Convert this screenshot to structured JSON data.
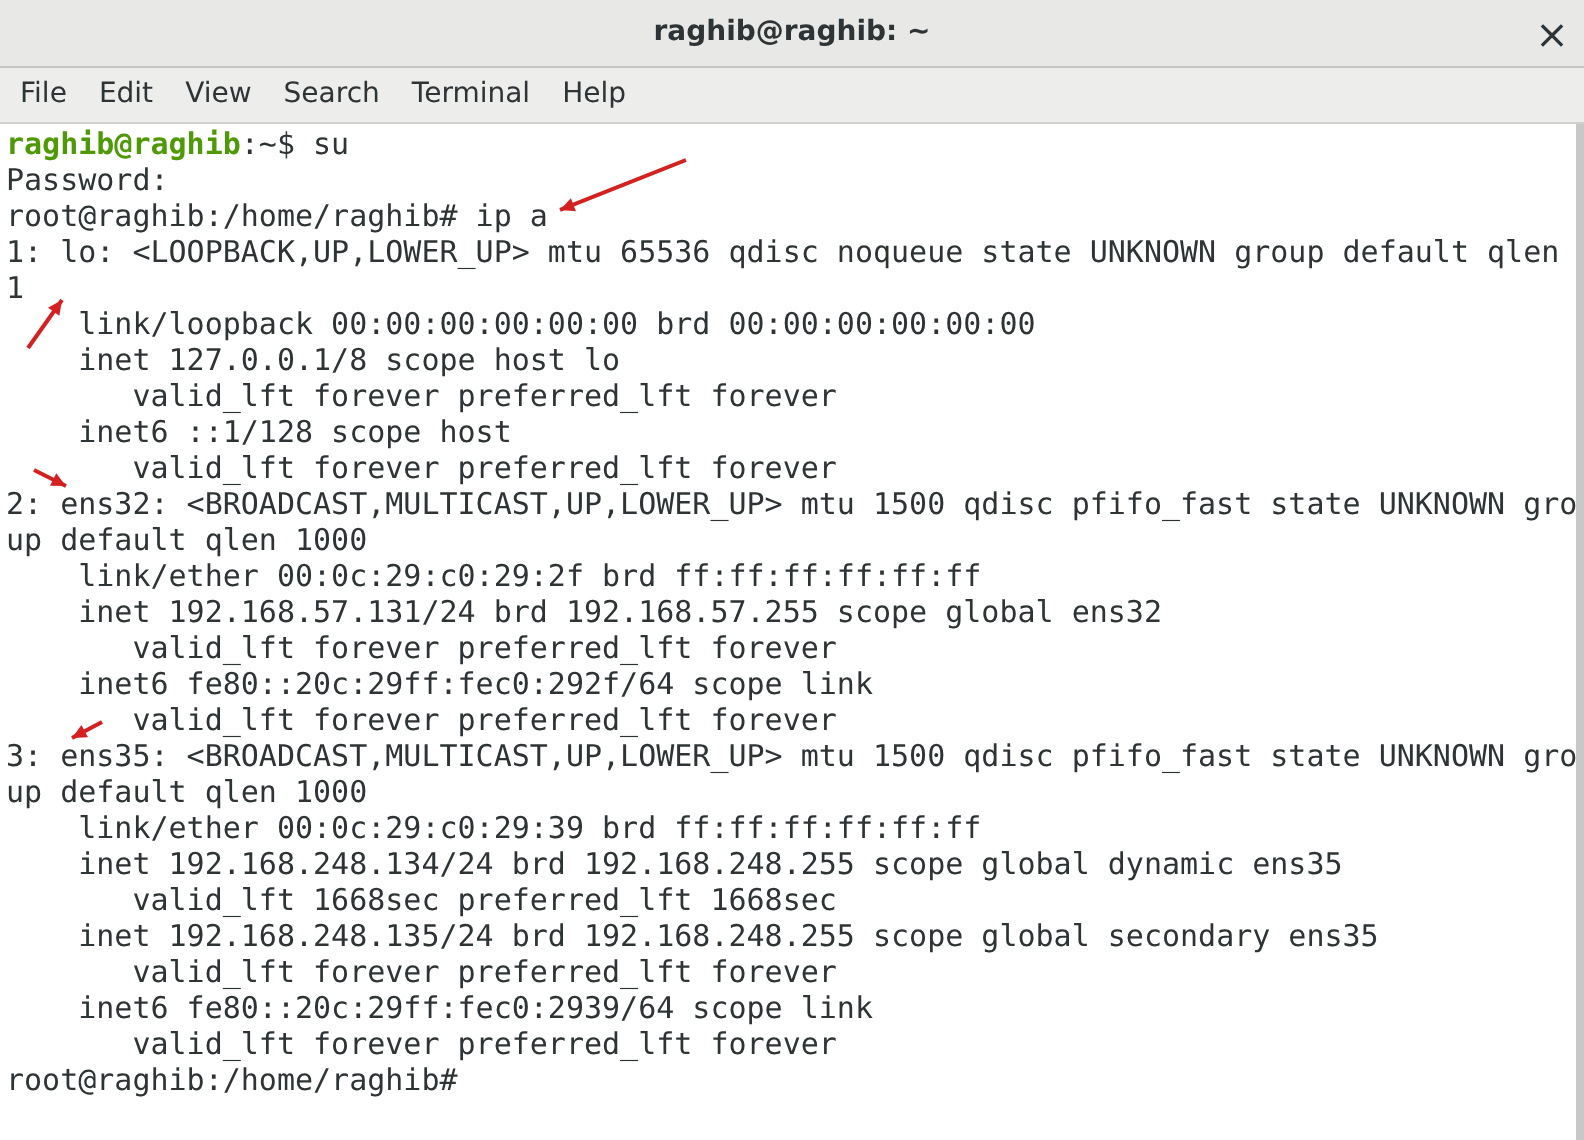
{
  "window": {
    "title": "raghib@raghib: ~",
    "close": "×"
  },
  "menu": [
    "File",
    "Edit",
    "View",
    "Search",
    "Terminal",
    "Help"
  ],
  "terminal_lines": [
    {
      "kind": "prompt",
      "user_host": "raghib@raghib",
      "rest": ":~$ su"
    },
    {
      "kind": "output",
      "text": "Password:"
    },
    {
      "kind": "output",
      "text": "root@raghib:/home/raghib# ip a"
    },
    {
      "kind": "output",
      "text": "1: lo: <LOOPBACK,UP,LOWER_UP> mtu 65536 qdisc noqueue state UNKNOWN group default qlen"
    },
    {
      "kind": "output",
      "text": "1"
    },
    {
      "kind": "output",
      "text": "    link/loopback 00:00:00:00:00:00 brd 00:00:00:00:00:00"
    },
    {
      "kind": "output",
      "text": "    inet 127.0.0.1/8 scope host lo"
    },
    {
      "kind": "output",
      "text": "       valid_lft forever preferred_lft forever"
    },
    {
      "kind": "output",
      "text": "    inet6 ::1/128 scope host"
    },
    {
      "kind": "output",
      "text": "       valid_lft forever preferred_lft forever"
    },
    {
      "kind": "output",
      "text": "2: ens32: <BROADCAST,MULTICAST,UP,LOWER_UP> mtu 1500 qdisc pfifo_fast state UNKNOWN gro"
    },
    {
      "kind": "output",
      "text": "up default qlen 1000"
    },
    {
      "kind": "output",
      "text": "    link/ether 00:0c:29:c0:29:2f brd ff:ff:ff:ff:ff:ff"
    },
    {
      "kind": "output",
      "text": "    inet 192.168.57.131/24 brd 192.168.57.255 scope global ens32"
    },
    {
      "kind": "output",
      "text": "       valid_lft forever preferred_lft forever"
    },
    {
      "kind": "output",
      "text": "    inet6 fe80::20c:29ff:fec0:292f/64 scope link"
    },
    {
      "kind": "output",
      "text": "       valid_lft forever preferred_lft forever"
    },
    {
      "kind": "output",
      "text": "3: ens35: <BROADCAST,MULTICAST,UP,LOWER_UP> mtu 1500 qdisc pfifo_fast state UNKNOWN gro"
    },
    {
      "kind": "output",
      "text": "up default qlen 1000"
    },
    {
      "kind": "output",
      "text": "    link/ether 00:0c:29:c0:29:39 brd ff:ff:ff:ff:ff:ff"
    },
    {
      "kind": "output",
      "text": "    inet 192.168.248.134/24 brd 192.168.248.255 scope global dynamic ens35"
    },
    {
      "kind": "output",
      "text": "       valid_lft 1668sec preferred_lft 1668sec"
    },
    {
      "kind": "output",
      "text": "    inet 192.168.248.135/24 brd 192.168.248.255 scope global secondary ens35"
    },
    {
      "kind": "output",
      "text": "       valid_lft forever preferred_lft forever"
    },
    {
      "kind": "output",
      "text": "    inet6 fe80::20c:29ff:fec0:2939/64 scope link"
    },
    {
      "kind": "output",
      "text": "       valid_lft forever preferred_lft forever"
    },
    {
      "kind": "output",
      "text": "root@raghib:/home/raghib#"
    }
  ]
}
